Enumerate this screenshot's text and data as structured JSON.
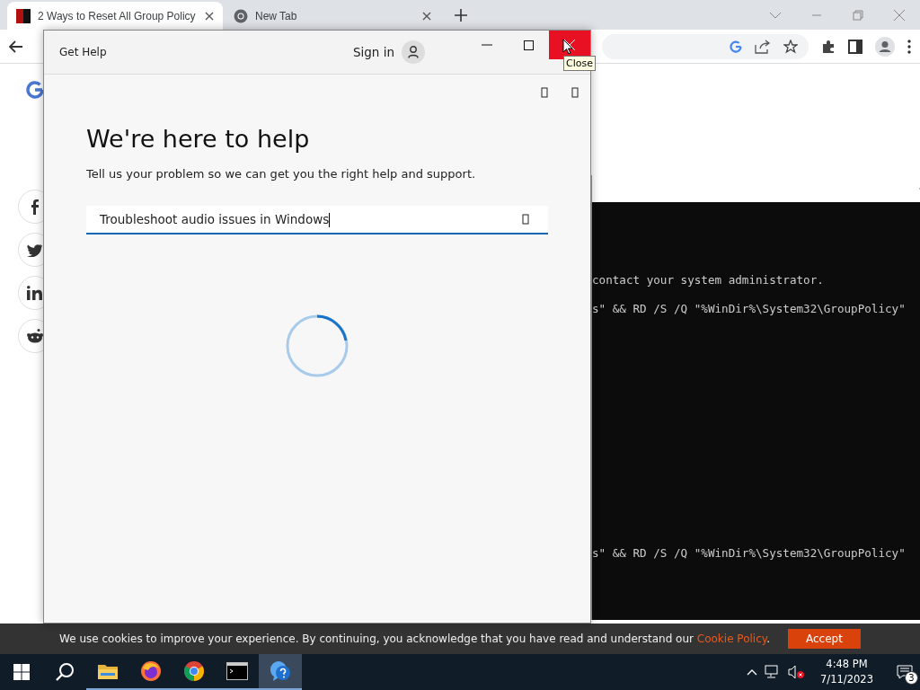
{
  "browser": {
    "tabs": [
      {
        "title": "2 Ways to Reset All Group Policy",
        "selected": true
      },
      {
        "title": "New Tab",
        "selected": false
      }
    ],
    "cookie_banner": {
      "text": "We use cookies to improve your experience. By continuing, you acknowledge that you have read and understand our ",
      "link": "Cookie Policy",
      "end": ".",
      "button": "Accept"
    }
  },
  "console": {
    "lines": [
      "contact your system administrator.",
      "s\" && RD /S /Q \"%WinDir%\\System32\\GroupPolicy\"",
      "s\" && RD /S /Q \"%WinDir%\\System32\\GroupPolicy\""
    ]
  },
  "get_help": {
    "title": "Get Help",
    "sign_in": "Sign in",
    "tooltip": "Close",
    "heading": "We're here to help",
    "subtitle": "Tell us your problem so we can get you the right help and support.",
    "search": {
      "value": "Troubleshoot audio issues in Windows"
    }
  },
  "taskbar": {
    "apps": [
      {
        "kind": "explorer",
        "selected": false
      },
      {
        "kind": "firefox",
        "selected": false
      },
      {
        "kind": "chrome",
        "selected": false
      },
      {
        "kind": "terminal",
        "selected": false
      },
      {
        "kind": "help",
        "selected": true
      }
    ],
    "time": "4:48 PM",
    "date": "7/11/2023",
    "notifications": "3"
  }
}
